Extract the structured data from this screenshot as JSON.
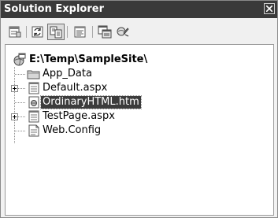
{
  "panel": {
    "title": "Solution Explorer"
  },
  "toolbar": {
    "buttons": [
      {
        "icon": "properties-icon",
        "pressed": false
      },
      {
        "icon": "refresh-icon",
        "pressed": false
      },
      {
        "icon": "show-all-files-icon",
        "pressed": true
      },
      {
        "icon": "view-code-icon",
        "pressed": false
      },
      {
        "icon": "view-designer-icon",
        "pressed": false
      },
      {
        "icon": "copy-website-icon",
        "pressed": false
      }
    ]
  },
  "tree": {
    "root": {
      "label": "E:\\Temp\\SampleSite\\",
      "icon": "website-icon"
    },
    "items": [
      {
        "label": "App_Data",
        "icon": "folder-icon",
        "expandable": false,
        "selected": false
      },
      {
        "label": "Default.aspx",
        "icon": "aspx-file-icon",
        "expandable": true,
        "selected": false
      },
      {
        "label": "OrdinaryHTML.htm",
        "icon": "html-file-icon",
        "expandable": false,
        "selected": true
      },
      {
        "label": "TestPage.aspx",
        "icon": "aspx-file-icon",
        "expandable": true,
        "selected": false
      },
      {
        "label": "Web.Config",
        "icon": "config-file-icon",
        "expandable": false,
        "selected": false
      }
    ]
  }
}
